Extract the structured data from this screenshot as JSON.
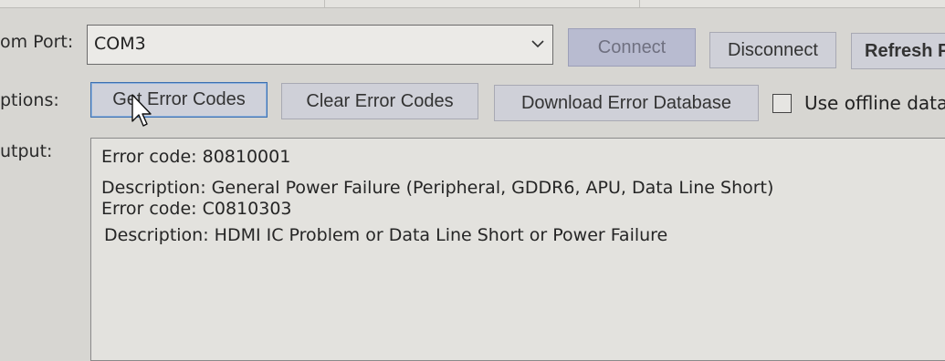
{
  "form": {
    "com_port_label": "om Port:",
    "options_label": "ptions:",
    "output_label": "utput:"
  },
  "com_port": {
    "selected": "COM3",
    "arrow_icon": "chevron-down-icon"
  },
  "connection_buttons": {
    "connect": "Connect",
    "disconnect": "Disconnect",
    "refresh": "Refresh P"
  },
  "option_buttons": {
    "get_error_codes": "Get Error Codes",
    "clear_error_codes": "Clear Error Codes",
    "download_error_database": "Download Error Database"
  },
  "offline_checkbox": {
    "label": "Use offline data",
    "checked": false
  },
  "output": {
    "lines": [
      "Error code: 80810001",
      "Description: General Power Failure (Peripheral, GDDR6, APU, Data Line Short)",
      "Error code: C0810303",
      "Description: HDMI IC Problem or Data Line Short or Power Failure"
    ]
  },
  "cursor_icon": "mouse-pointer-icon"
}
